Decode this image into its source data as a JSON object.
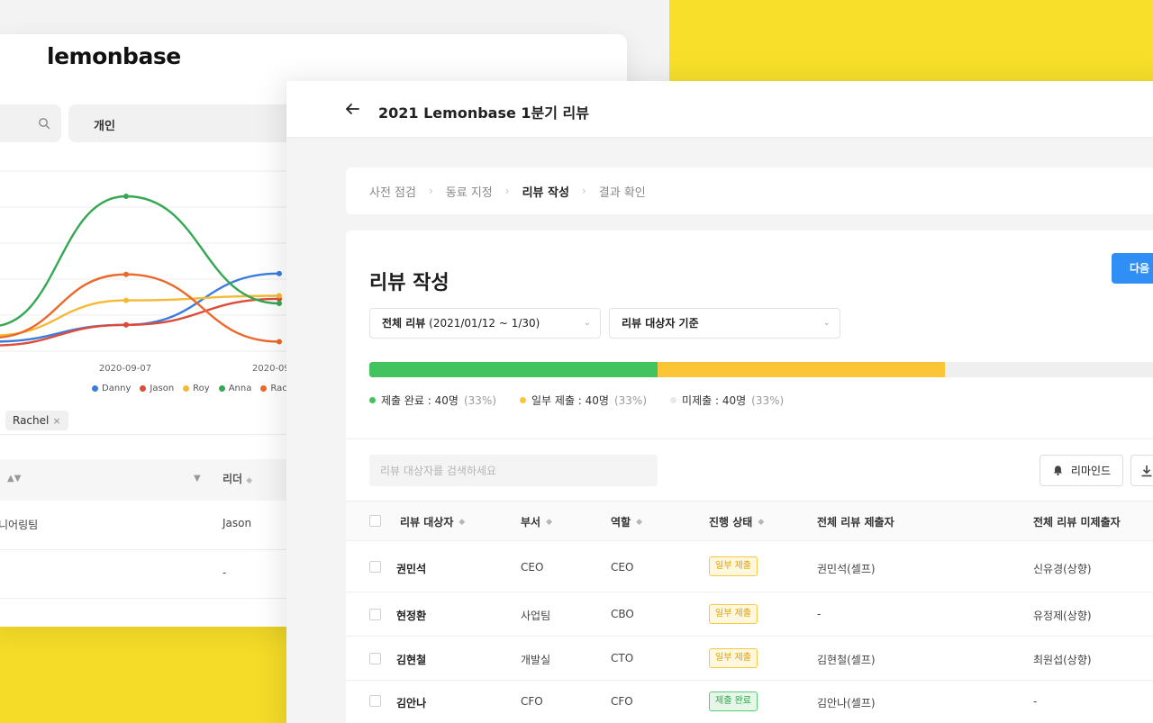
{
  "back_window": {
    "logo": "lemonbase",
    "filter_label": "개인",
    "chart_data": {
      "type": "line",
      "categories": [
        "",
        "2020-09-07",
        "2020-09"
      ],
      "series": [
        {
          "name": "Danny",
          "color": "#3b7ddd",
          "values": [
            10,
            32,
            99
          ]
        },
        {
          "name": "Jason",
          "color": "#dd4b39",
          "values": [
            5,
            32,
            66
          ]
        },
        {
          "name": "Roy",
          "color": "#f5b935",
          "values": [
            18,
            64,
            70
          ]
        },
        {
          "name": "Anna",
          "color": "#34a853",
          "values": [
            30,
            200,
            60
          ]
        },
        {
          "name": "Rachel",
          "color": "#ea6a2a",
          "values": [
            15,
            98,
            10
          ]
        }
      ],
      "xlabel": "",
      "ylabel": ""
    },
    "legend": [
      {
        "name": "Danny",
        "color": "#3b7ddd"
      },
      {
        "name": "Jason",
        "color": "#dd4b39"
      },
      {
        "name": "Roy",
        "color": "#f5b935"
      },
      {
        "name": "Anna",
        "color": "#34a853"
      },
      {
        "name": "Rac",
        "color": "#ea6a2a"
      }
    ],
    "chip_rachel": "Rachel",
    "chip_close": "×",
    "col_leader": "리더",
    "row1_dept": "니어링팀",
    "row1_leader": "Jason",
    "row2_leader": "-"
  },
  "front": {
    "title": "2021 Lemonbase 1분기 리뷰",
    "steps": [
      "사전 점검",
      "동료 지정",
      "리뷰 작성",
      "결과 확인"
    ],
    "step_chevron": "›",
    "section_title": "리뷰 작성",
    "next_button": "다음",
    "select_period_bold": "전체 리뷰",
    "select_period_rest": " (2021/01/12 ~ 1/30)",
    "select_basis": "리뷰 대상자 기준",
    "select_chevron": "⌄",
    "progress": {
      "done": 0.355,
      "partial": 0.355
    },
    "legend": [
      {
        "label": "제출 완료 : 40명",
        "pct": "(33%)",
        "color": "#43c35e"
      },
      {
        "label": "일부 제출 : 40명",
        "pct": "(33%)",
        "color": "#fbc537"
      },
      {
        "label": "미제출 : 40명",
        "pct": "(33%)",
        "color": "#e8e8e8"
      }
    ],
    "search_placeholder": "리뷰 대상자를 검색하세요",
    "remind_button": "리마인드",
    "columns": {
      "target": "리뷰 대상자",
      "dept": "부서",
      "role": "역할",
      "status": "진행 상태",
      "submitters": "전체 리뷰 제출자",
      "non_submitters": "전체 리뷰 미제출자"
    },
    "sort_glyph": "◆",
    "rows": [
      {
        "name": "권민석",
        "dept": "CEO",
        "role": "CEO",
        "status": "일부 제출",
        "status_type": "partial",
        "submitter": "권민석(셀프)",
        "non_submitter": "신유경(상향)"
      },
      {
        "name": "현정환",
        "dept": "사업팀",
        "role": "CBO",
        "status": "일부 제출",
        "status_type": "partial",
        "submitter": "-",
        "non_submitter": "유정제(상향)"
      },
      {
        "name": "김현철",
        "dept": "개발실",
        "role": "CTO",
        "status": "일부 제출",
        "status_type": "partial",
        "submitter": "김현철(셀프)",
        "non_submitter": "최원섭(상향)"
      },
      {
        "name": "김안나",
        "dept": "CFO",
        "role": "CFO",
        "status": "제출 완료",
        "status_type": "done",
        "submitter": "김안나(셀프)",
        "non_submitter": "-"
      }
    ]
  }
}
